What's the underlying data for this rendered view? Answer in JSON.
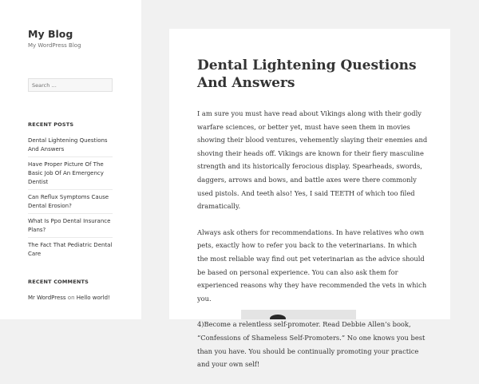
{
  "site": {
    "title": "My Blog",
    "description": "My WordPress Blog"
  },
  "search": {
    "placeholder": "Search …"
  },
  "recent_posts": {
    "title": "RECENT POSTS",
    "items": [
      "Dental Lightening Questions And Answers",
      "Have Proper Picture Of The Basic Job Of An Emergency Dentist",
      "Can Reflux Symptoms Cause Dental Erosion?",
      "What Is Ppo Dental Insurance Plans?",
      "The Fact That Pediatric Dental Care"
    ]
  },
  "recent_comments": {
    "title": "RECENT COMMENTS",
    "author": "Mr WordPress",
    "on": "on",
    "post": "Hello world!"
  },
  "post": {
    "title": "Dental Lightening Questions And Answers",
    "paragraphs": [
      "I am sure you must have read about Vikings along with their godly warfare sciences, or better yet, must have seen them in movies showing their blood ventures, vehemently slaying their enemies and shoving their heads off. Vikings are known for their fiery masculine strength and its historically ferocious display. Spearheads, swords, daggers, arrows and bows, and battle axes were there commonly used pistols. And teeth also! Yes, I said TEETH of which too filed dramatically.",
      "Always ask others for recommendations. In have relatives who own pets, exactly how to refer you back to the veterinarians. In which the most reliable way find out pet veterinarian as the advice should be based on personal experience. You can also ask them for experienced reasons why they have recommended the vets in which you.",
      "4)Become a relentless self-promoter. Read Debbie Allen’s book, “Confessions of Shameless Self-Promoters.” No one knows you best than you have. You should be continually promoting your practice and your own self!"
    ]
  }
}
